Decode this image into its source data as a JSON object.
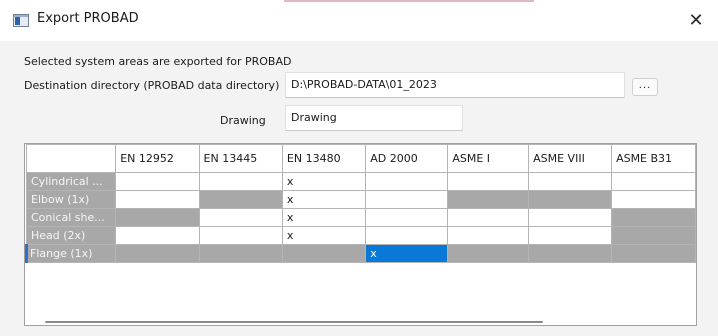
{
  "window": {
    "title": "Export PROBAD",
    "close_glyph": "✕"
  },
  "form": {
    "intro": "Selected system areas are exported for PROBAD",
    "destination_label": "Destination directory (PROBAD data directory)",
    "destination_value": "D:\\PROBAD-DATA\\01_2023",
    "browse_label": "...",
    "drawing_label": "Drawing",
    "drawing_value": "Drawing"
  },
  "grid": {
    "columns": [
      "EN 12952",
      "EN 13445",
      "EN 13480",
      "AD 2000",
      "ASME I",
      "ASME VIII",
      "ASME B31"
    ],
    "rows": [
      {
        "label": "Cylindrical ...",
        "cells": [
          {
            "v": "",
            "s": "on"
          },
          {
            "v": "",
            "s": "on"
          },
          {
            "v": "x",
            "s": "on"
          },
          {
            "v": "",
            "s": "on"
          },
          {
            "v": "",
            "s": "on"
          },
          {
            "v": "",
            "s": "on"
          },
          {
            "v": "",
            "s": "on"
          }
        ]
      },
      {
        "label": "Elbow (1x)",
        "cells": [
          {
            "v": "",
            "s": "on"
          },
          {
            "v": "",
            "s": "off"
          },
          {
            "v": "x",
            "s": "on"
          },
          {
            "v": "",
            "s": "on"
          },
          {
            "v": "",
            "s": "off"
          },
          {
            "v": "",
            "s": "off"
          },
          {
            "v": "",
            "s": "on"
          }
        ]
      },
      {
        "label": "Conical she...",
        "cells": [
          {
            "v": "",
            "s": "off"
          },
          {
            "v": "",
            "s": "on"
          },
          {
            "v": "x",
            "s": "on"
          },
          {
            "v": "",
            "s": "on"
          },
          {
            "v": "",
            "s": "on"
          },
          {
            "v": "",
            "s": "on"
          },
          {
            "v": "",
            "s": "off"
          }
        ]
      },
      {
        "label": "Head (2x)",
        "cells": [
          {
            "v": "",
            "s": "on"
          },
          {
            "v": "",
            "s": "on"
          },
          {
            "v": "x",
            "s": "on"
          },
          {
            "v": "",
            "s": "on"
          },
          {
            "v": "",
            "s": "on"
          },
          {
            "v": "",
            "s": "on"
          },
          {
            "v": "",
            "s": "off"
          }
        ]
      },
      {
        "label": "Flange (1x)",
        "current": true,
        "cells": [
          {
            "v": "",
            "s": "off"
          },
          {
            "v": "",
            "s": "off"
          },
          {
            "v": "",
            "s": "off"
          },
          {
            "v": "x",
            "s": "sel"
          },
          {
            "v": "",
            "s": "off"
          },
          {
            "v": "",
            "s": "off"
          },
          {
            "v": "",
            "s": "off"
          }
        ]
      }
    ]
  },
  "colors": {
    "disabled_cell": "#a8a8a8",
    "selected_cell": "#0a78d7",
    "current_row_marker": "#2f6fcf"
  }
}
